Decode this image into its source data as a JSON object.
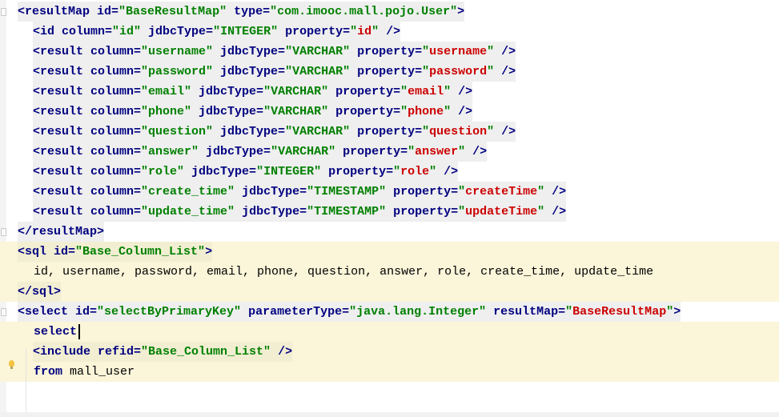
{
  "editor": {
    "lines": [
      {
        "highlight": false,
        "tag": true,
        "tokens": [
          {
            "t": "<resultMap ",
            "c": "b"
          },
          {
            "t": "id=",
            "c": "b"
          },
          {
            "t": "\"BaseResultMap\"",
            "c": "g"
          },
          {
            "t": " type=",
            "c": "b"
          },
          {
            "t": "\"com.imooc.mall.pojo.User\"",
            "c": "g"
          },
          {
            "t": ">",
            "c": "b"
          }
        ]
      },
      {
        "highlight": false,
        "tag": true,
        "tokens": [
          {
            "t": "<id ",
            "c": "b"
          },
          {
            "t": "column=",
            "c": "b"
          },
          {
            "t": "\"id\"",
            "c": "g"
          },
          {
            "t": " jdbcType=",
            "c": "b"
          },
          {
            "t": "\"INTEGER\"",
            "c": "g"
          },
          {
            "t": " property=",
            "c": "b"
          },
          {
            "t": "\"",
            "c": "g"
          },
          {
            "t": "id",
            "c": "r"
          },
          {
            "t": "\"",
            "c": "g"
          },
          {
            "t": " />",
            "c": "b"
          }
        ]
      },
      {
        "highlight": false,
        "tag": true,
        "tokens": [
          {
            "t": "<result ",
            "c": "b"
          },
          {
            "t": "column=",
            "c": "b"
          },
          {
            "t": "\"username\"",
            "c": "g"
          },
          {
            "t": " jdbcType=",
            "c": "b"
          },
          {
            "t": "\"VARCHAR\"",
            "c": "g"
          },
          {
            "t": " property=",
            "c": "b"
          },
          {
            "t": "\"",
            "c": "g"
          },
          {
            "t": "username",
            "c": "r"
          },
          {
            "t": "\"",
            "c": "g"
          },
          {
            "t": " />",
            "c": "b"
          }
        ]
      },
      {
        "highlight": false,
        "tag": true,
        "tokens": [
          {
            "t": "<result ",
            "c": "b"
          },
          {
            "t": "column=",
            "c": "b"
          },
          {
            "t": "\"password\"",
            "c": "g"
          },
          {
            "t": " jdbcType=",
            "c": "b"
          },
          {
            "t": "\"VARCHAR\"",
            "c": "g"
          },
          {
            "t": " property=",
            "c": "b"
          },
          {
            "t": "\"",
            "c": "g"
          },
          {
            "t": "password",
            "c": "r"
          },
          {
            "t": "\"",
            "c": "g"
          },
          {
            "t": " />",
            "c": "b"
          }
        ]
      },
      {
        "highlight": false,
        "tag": true,
        "tokens": [
          {
            "t": "<result ",
            "c": "b"
          },
          {
            "t": "column=",
            "c": "b"
          },
          {
            "t": "\"email\"",
            "c": "g"
          },
          {
            "t": " jdbcType=",
            "c": "b"
          },
          {
            "t": "\"VARCHAR\"",
            "c": "g"
          },
          {
            "t": " property=",
            "c": "b"
          },
          {
            "t": "\"",
            "c": "g"
          },
          {
            "t": "email",
            "c": "r"
          },
          {
            "t": "\"",
            "c": "g"
          },
          {
            "t": " />",
            "c": "b"
          }
        ]
      },
      {
        "highlight": false,
        "tag": true,
        "tokens": [
          {
            "t": "<result ",
            "c": "b"
          },
          {
            "t": "column=",
            "c": "b"
          },
          {
            "t": "\"phone\"",
            "c": "g"
          },
          {
            "t": " jdbcType=",
            "c": "b"
          },
          {
            "t": "\"VARCHAR\"",
            "c": "g"
          },
          {
            "t": " property=",
            "c": "b"
          },
          {
            "t": "\"",
            "c": "g"
          },
          {
            "t": "phone",
            "c": "r"
          },
          {
            "t": "\"",
            "c": "g"
          },
          {
            "t": " />",
            "c": "b"
          }
        ]
      },
      {
        "highlight": false,
        "tag": true,
        "tokens": [
          {
            "t": "<result ",
            "c": "b"
          },
          {
            "t": "column=",
            "c": "b"
          },
          {
            "t": "\"question\"",
            "c": "g"
          },
          {
            "t": " jdbcType=",
            "c": "b"
          },
          {
            "t": "\"VARCHAR\"",
            "c": "g"
          },
          {
            "t": " property=",
            "c": "b"
          },
          {
            "t": "\"",
            "c": "g"
          },
          {
            "t": "question",
            "c": "r"
          },
          {
            "t": "\"",
            "c": "g"
          },
          {
            "t": " />",
            "c": "b"
          }
        ]
      },
      {
        "highlight": false,
        "tag": true,
        "tokens": [
          {
            "t": "<result ",
            "c": "b"
          },
          {
            "t": "column=",
            "c": "b"
          },
          {
            "t": "\"answer\"",
            "c": "g"
          },
          {
            "t": " jdbcType=",
            "c": "b"
          },
          {
            "t": "\"VARCHAR\"",
            "c": "g"
          },
          {
            "t": " property=",
            "c": "b"
          },
          {
            "t": "\"",
            "c": "g"
          },
          {
            "t": "answer",
            "c": "r"
          },
          {
            "t": "\"",
            "c": "g"
          },
          {
            "t": " />",
            "c": "b"
          }
        ]
      },
      {
        "highlight": false,
        "tag": true,
        "tokens": [
          {
            "t": "<result ",
            "c": "b"
          },
          {
            "t": "column=",
            "c": "b"
          },
          {
            "t": "\"role\"",
            "c": "g"
          },
          {
            "t": " jdbcType=",
            "c": "b"
          },
          {
            "t": "\"INTEGER\"",
            "c": "g"
          },
          {
            "t": " property=",
            "c": "b"
          },
          {
            "t": "\"",
            "c": "g"
          },
          {
            "t": "role",
            "c": "r"
          },
          {
            "t": "\"",
            "c": "g"
          },
          {
            "t": " />",
            "c": "b"
          }
        ]
      },
      {
        "highlight": false,
        "tag": true,
        "tokens": [
          {
            "t": "<result ",
            "c": "b"
          },
          {
            "t": "column=",
            "c": "b"
          },
          {
            "t": "\"create_time\"",
            "c": "g"
          },
          {
            "t": " jdbcType=",
            "c": "b"
          },
          {
            "t": "\"TIMESTAMP\"",
            "c": "g"
          },
          {
            "t": " property=",
            "c": "b"
          },
          {
            "t": "\"",
            "c": "g"
          },
          {
            "t": "createTime",
            "c": "r"
          },
          {
            "t": "\"",
            "c": "g"
          },
          {
            "t": " />",
            "c": "b"
          }
        ]
      },
      {
        "highlight": false,
        "tag": true,
        "tokens": [
          {
            "t": "<result ",
            "c": "b"
          },
          {
            "t": "column=",
            "c": "b"
          },
          {
            "t": "\"update_time\"",
            "c": "g"
          },
          {
            "t": " jdbcType=",
            "c": "b"
          },
          {
            "t": "\"TIMESTAMP\"",
            "c": "g"
          },
          {
            "t": " property=",
            "c": "b"
          },
          {
            "t": "\"",
            "c": "g"
          },
          {
            "t": "updateTime",
            "c": "r"
          },
          {
            "t": "\"",
            "c": "g"
          },
          {
            "t": " />",
            "c": "b"
          }
        ]
      },
      {
        "highlight": false,
        "tag": true,
        "tokens": [
          {
            "t": "</resultMap>",
            "c": "b"
          }
        ]
      },
      {
        "highlight": true,
        "tag": true,
        "tokens": [
          {
            "t": "<sql ",
            "c": "b"
          },
          {
            "t": "id=",
            "c": "b"
          },
          {
            "t": "\"Base_Column_List\"",
            "c": "g"
          },
          {
            "t": ">",
            "c": "b"
          }
        ]
      },
      {
        "highlight": true,
        "tag": false,
        "tokens": [
          {
            "t": "id, username, password, email, phone, question, answer, role, create_time, update_time",
            "c": "p"
          }
        ]
      },
      {
        "highlight": true,
        "tag": true,
        "tokens": [
          {
            "t": "</sql>",
            "c": "b"
          }
        ]
      },
      {
        "highlight": false,
        "tag": true,
        "tokens": [
          {
            "t": "<select ",
            "c": "b"
          },
          {
            "t": "id=",
            "c": "b"
          },
          {
            "t": "\"selectByPrimaryKey\"",
            "c": "g"
          },
          {
            "t": " parameterType=",
            "c": "b"
          },
          {
            "t": "\"java.lang.Integer\"",
            "c": "g"
          },
          {
            "t": " resultMap=",
            "c": "b"
          },
          {
            "t": "\"",
            "c": "g"
          },
          {
            "t": "BaseResultMap",
            "c": "r"
          },
          {
            "t": "\"",
            "c": "g"
          },
          {
            "t": ">",
            "c": "b"
          }
        ]
      },
      {
        "highlight": true,
        "tag": false,
        "caret": true,
        "tokens": [
          {
            "t": "select",
            "c": "k"
          }
        ]
      },
      {
        "highlight": true,
        "tag": true,
        "tokens": [
          {
            "t": "<include ",
            "c": "b"
          },
          {
            "t": "refid=",
            "c": "b"
          },
          {
            "t": "\"Base_Column_List\"",
            "c": "g"
          },
          {
            "t": " />",
            "c": "b"
          }
        ]
      },
      {
        "highlight": true,
        "tag": false,
        "tokens": [
          {
            "t": "from",
            "c": "k"
          },
          {
            "t": " mall_user",
            "c": "p"
          }
        ]
      }
    ]
  },
  "gutter": {
    "fold_lines": [
      0,
      11,
      12,
      14,
      15
    ],
    "intention_icon": "lightbulb-icon"
  },
  "colors": {
    "tag": "#000080",
    "string": "#008000",
    "property_value": "#cc0000",
    "highlight_bg": "#fbf5d9"
  }
}
